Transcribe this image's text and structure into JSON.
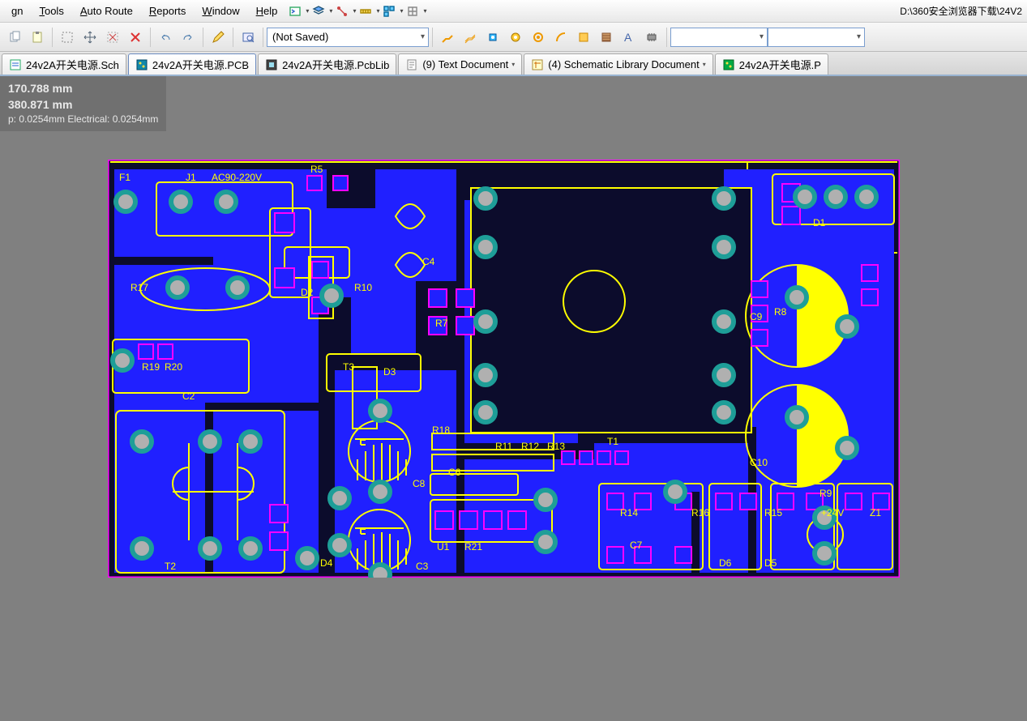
{
  "title_path": "D:\\360安全浏览器下载\\24V2",
  "menubar": {
    "items": [
      {
        "label": "gn",
        "ul": ""
      },
      {
        "label": "Tools",
        "ul": "T"
      },
      {
        "label": "Auto Route",
        "ul": "A"
      },
      {
        "label": "Reports",
        "ul": "R"
      },
      {
        "label": "Window",
        "ul": "W"
      },
      {
        "label": "Help",
        "ul": "H"
      }
    ]
  },
  "toolbar": {
    "layer_combo": "(Not Saved)"
  },
  "tabs": [
    {
      "label": "24v2A开关电源.Sch",
      "icon": "sch-icon"
    },
    {
      "label": "24v2A开关电源.PCB",
      "icon": "pcb-icon",
      "active": true
    },
    {
      "label": "24v2A开关电源.PcbLib",
      "icon": "pcblib-icon"
    },
    {
      "label": "(9) Text Document",
      "icon": "text-icon",
      "dropdown": true
    },
    {
      "label": "(4) Schematic Library Document",
      "icon": "schlib-icon",
      "dropdown": true
    },
    {
      "label": "24v2A开关电源.P",
      "icon": "pcb-green-icon"
    }
  ],
  "coords": {
    "x": "170.788 mm",
    "y": "380.871 mm",
    "snap": "p: 0.0254mm Electrical: 0.0254mm"
  },
  "pcb": {
    "labels": {
      "F1": "F1",
      "J1": "J1",
      "AC": "AC90-220V",
      "C4": "C4",
      "R17": "R17",
      "R19": "R19",
      "R20": "R20",
      "C2": "C2",
      "T2": "T2",
      "D4": "D4",
      "T3": "T3",
      "D3": "D3",
      "D2": "D2",
      "R10": "R10",
      "R18": "R18",
      "C8": "C8",
      "C6": "C6",
      "U1": "U1",
      "R21": "R21",
      "R11": "R11",
      "R12": "R12",
      "R13": "R13",
      "T1": "T1",
      "R14": "R14",
      "R16": "R16",
      "C7": "C7",
      "D6": "D6",
      "D5": "D5",
      "R15": "R15",
      "V24": "+24V",
      "Z1": "Z1",
      "C10": "C10",
      "C9": "C9",
      "R8": "R8",
      "D1": "D1",
      "R5": "R5",
      "C3": "C3",
      "R9": "R9",
      "R7": "R7"
    },
    "colors": {
      "outline": "#ff00ff",
      "silk": "#ffff00",
      "copper": "#2020ff",
      "copper2": "#0000d0",
      "bg": "#0c0c2c",
      "pad_ring": "#1e9e98",
      "pad_fill": "#b0b0b0",
      "ic_body": "#101020"
    }
  }
}
